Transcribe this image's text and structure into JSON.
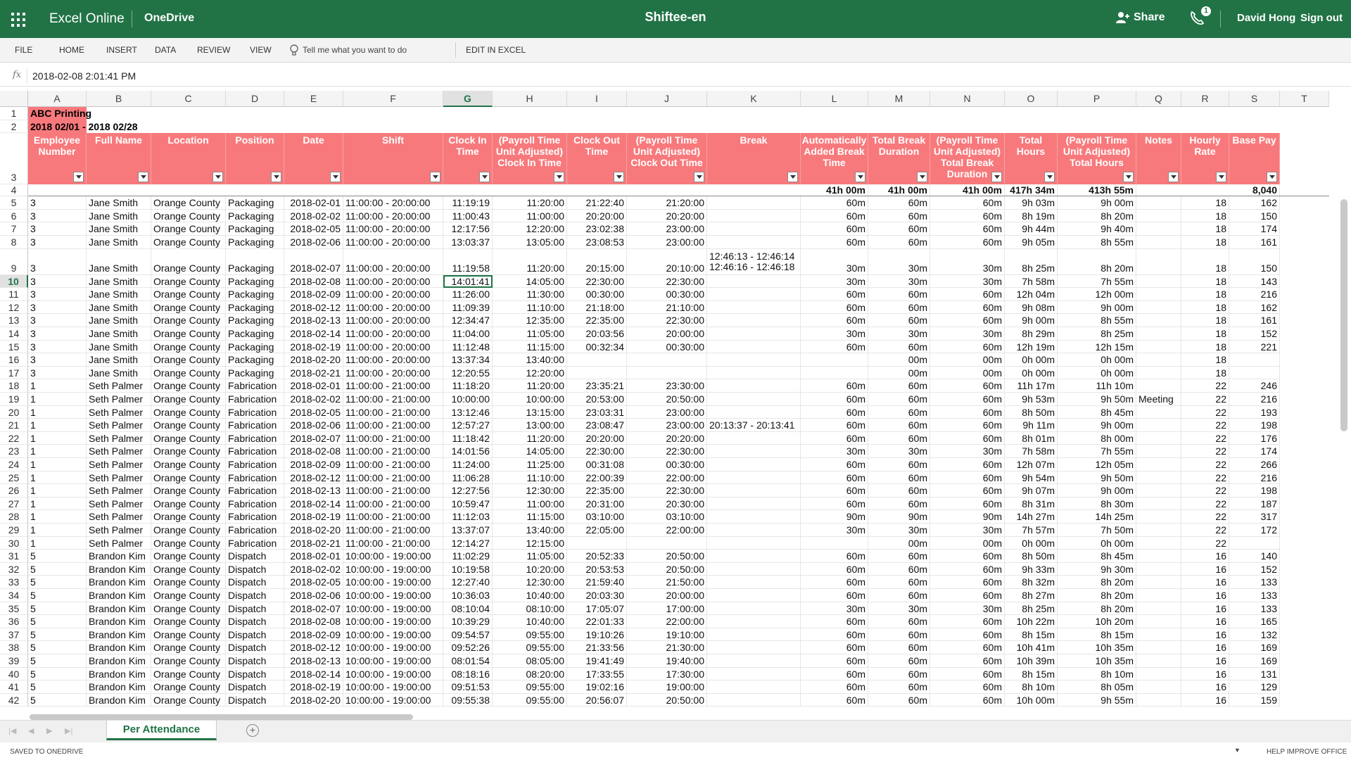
{
  "app": {
    "name": "Excel Online",
    "service": "OneDrive",
    "doc_title": "Shiftee-en",
    "share": "Share",
    "notification_count": "1",
    "user": "David Hong",
    "signout": "Sign out"
  },
  "ribbon": {
    "tabs": [
      "FILE",
      "HOME",
      "INSERT",
      "DATA",
      "REVIEW",
      "VIEW"
    ],
    "tellme": "Tell me what you want to do",
    "edit_in_excel": "EDIT IN EXCEL"
  },
  "formula": {
    "fx": "fx",
    "value": "2018-02-08  2:01:41 PM"
  },
  "columns": [
    "A",
    "B",
    "C",
    "D",
    "E",
    "F",
    "G",
    "H",
    "I",
    "J",
    "K",
    "L",
    "M",
    "N",
    "O",
    "P",
    "Q",
    "R",
    "S",
    "T"
  ],
  "selected_column": "G",
  "selected_row": "10",
  "sheet_title": "ABC Printing",
  "sheet_period": "2018 02/01 - 2018 02/28",
  "headers": [
    "Employee Number",
    "Full Name",
    "Location",
    "Position",
    "Date",
    "Shift",
    "Clock In Time",
    "(Payroll Time Unit Adjusted) Clock In Time",
    "Clock Out Time",
    "(Payroll Time Unit Adjusted) Clock Out Time",
    "Break",
    "Automatically Added Break Time",
    "Total Break Duration",
    "(Payroll Time Unit Adjusted) Total Break Duration",
    "Total Hours",
    "(Payroll Time Unit Adjusted) Total Hours",
    "Notes",
    "Hourly Rate",
    "Base Pay"
  ],
  "totals": {
    "L": "41h 00m",
    "M": "41h 00m",
    "N": "41h 00m",
    "O": "417h 34m",
    "P": "413h 55m",
    "S": "8,040"
  },
  "rows": [
    [
      "5",
      "3",
      "Jane Smith",
      "Orange County",
      "Packaging",
      "2018-02-01",
      "11:00:00 - 20:00:00",
      "11:19:19",
      "11:20:00",
      "21:22:40",
      "21:20:00",
      "",
      "60m",
      "60m",
      "60m",
      "9h 03m",
      "9h 00m",
      "",
      "18",
      "162"
    ],
    [
      "6",
      "3",
      "Jane Smith",
      "Orange County",
      "Packaging",
      "2018-02-02",
      "11:00:00 - 20:00:00",
      "11:00:43",
      "11:00:00",
      "20:20:00",
      "20:20:00",
      "",
      "60m",
      "60m",
      "60m",
      "8h 19m",
      "8h 20m",
      "",
      "18",
      "150"
    ],
    [
      "7",
      "3",
      "Jane Smith",
      "Orange County",
      "Packaging",
      "2018-02-05",
      "11:00:00 - 20:00:00",
      "12:17:56",
      "12:20:00",
      "23:02:38",
      "23:00:00",
      "",
      "60m",
      "60m",
      "60m",
      "9h 44m",
      "9h 40m",
      "",
      "18",
      "174"
    ],
    [
      "8",
      "3",
      "Jane Smith",
      "Orange County",
      "Packaging",
      "2018-02-06",
      "11:00:00 - 20:00:00",
      "13:03:37",
      "13:05:00",
      "23:08:53",
      "23:00:00",
      "",
      "60m",
      "60m",
      "60m",
      "9h 05m",
      "8h 55m",
      "",
      "18",
      "161"
    ],
    [
      "9",
      "3",
      "Jane Smith",
      "Orange County",
      "Packaging",
      "2018-02-07",
      "11:00:00 - 20:00:00",
      "11:19:58",
      "11:20:00",
      "20:15:00",
      "20:10:00",
      "12:46:13 - 12:46:14\n12:46:16 - 12:46:18",
      "30m",
      "30m",
      "30m",
      "8h 25m",
      "8h 20m",
      "",
      "18",
      "150"
    ],
    [
      "10",
      "3",
      "Jane Smith",
      "Orange County",
      "Packaging",
      "2018-02-08",
      "11:00:00 - 20:00:00",
      "14:01:41",
      "14:05:00",
      "22:30:00",
      "22:30:00",
      "",
      "30m",
      "30m",
      "30m",
      "7h 58m",
      "7h 55m",
      "",
      "18",
      "143"
    ],
    [
      "11",
      "3",
      "Jane Smith",
      "Orange County",
      "Packaging",
      "2018-02-09",
      "11:00:00 - 20:00:00",
      "11:26:00",
      "11:30:00",
      "00:30:00",
      "00:30:00",
      "",
      "60m",
      "60m",
      "60m",
      "12h 04m",
      "12h 00m",
      "",
      "18",
      "216"
    ],
    [
      "12",
      "3",
      "Jane Smith",
      "Orange County",
      "Packaging",
      "2018-02-12",
      "11:00:00 - 20:00:00",
      "11:09:39",
      "11:10:00",
      "21:18:00",
      "21:10:00",
      "",
      "60m",
      "60m",
      "60m",
      "9h 08m",
      "9h 00m",
      "",
      "18",
      "162"
    ],
    [
      "13",
      "3",
      "Jane Smith",
      "Orange County",
      "Packaging",
      "2018-02-13",
      "11:00:00 - 20:00:00",
      "12:34:47",
      "12:35:00",
      "22:35:00",
      "22:30:00",
      "",
      "60m",
      "60m",
      "60m",
      "9h 00m",
      "8h 55m",
      "",
      "18",
      "161"
    ],
    [
      "14",
      "3",
      "Jane Smith",
      "Orange County",
      "Packaging",
      "2018-02-14",
      "11:00:00 - 20:00:00",
      "11:04:00",
      "11:05:00",
      "20:03:56",
      "20:00:00",
      "",
      "30m",
      "30m",
      "30m",
      "8h 29m",
      "8h 25m",
      "",
      "18",
      "152"
    ],
    [
      "15",
      "3",
      "Jane Smith",
      "Orange County",
      "Packaging",
      "2018-02-19",
      "11:00:00 - 20:00:00",
      "11:12:48",
      "11:15:00",
      "00:32:34",
      "00:30:00",
      "",
      "60m",
      "60m",
      "60m",
      "12h 19m",
      "12h 15m",
      "",
      "18",
      "221"
    ],
    [
      "16",
      "3",
      "Jane Smith",
      "Orange County",
      "Packaging",
      "2018-02-20",
      "11:00:00 - 20:00:00",
      "13:37:34",
      "13:40:00",
      "",
      "",
      "",
      "",
      "00m",
      "00m",
      "0h 00m",
      "0h 00m",
      "",
      "18",
      ""
    ],
    [
      "17",
      "3",
      "Jane Smith",
      "Orange County",
      "Packaging",
      "2018-02-21",
      "11:00:00 - 20:00:00",
      "12:20:55",
      "12:20:00",
      "",
      "",
      "",
      "",
      "00m",
      "00m",
      "0h 00m",
      "0h 00m",
      "",
      "18",
      ""
    ],
    [
      "18",
      "1",
      "Seth Palmer",
      "Orange County",
      "Fabrication",
      "2018-02-01",
      "11:00:00 - 21:00:00",
      "11:18:20",
      "11:20:00",
      "23:35:21",
      "23:30:00",
      "",
      "60m",
      "60m",
      "60m",
      "11h 17m",
      "11h 10m",
      "",
      "22",
      "246"
    ],
    [
      "19",
      "1",
      "Seth Palmer",
      "Orange County",
      "Fabrication",
      "2018-02-02",
      "11:00:00 - 21:00:00",
      "10:00:00",
      "10:00:00",
      "20:53:00",
      "20:50:00",
      "",
      "60m",
      "60m",
      "60m",
      "9h 53m",
      "9h 50m",
      "Meeting",
      "22",
      "216"
    ],
    [
      "20",
      "1",
      "Seth Palmer",
      "Orange County",
      "Fabrication",
      "2018-02-05",
      "11:00:00 - 21:00:00",
      "13:12:46",
      "13:15:00",
      "23:03:31",
      "23:00:00",
      "",
      "60m",
      "60m",
      "60m",
      "8h 50m",
      "8h 45m",
      "",
      "22",
      "193"
    ],
    [
      "21",
      "1",
      "Seth Palmer",
      "Orange County",
      "Fabrication",
      "2018-02-06",
      "11:00:00 - 21:00:00",
      "12:57:27",
      "13:00:00",
      "23:08:47",
      "23:00:00",
      "20:13:37 - 20:13:41",
      "60m",
      "60m",
      "60m",
      "9h 11m",
      "9h 00m",
      "",
      "22",
      "198"
    ],
    [
      "22",
      "1",
      "Seth Palmer",
      "Orange County",
      "Fabrication",
      "2018-02-07",
      "11:00:00 - 21:00:00",
      "11:18:42",
      "11:20:00",
      "20:20:00",
      "20:20:00",
      "",
      "60m",
      "60m",
      "60m",
      "8h 01m",
      "8h 00m",
      "",
      "22",
      "176"
    ],
    [
      "23",
      "1",
      "Seth Palmer",
      "Orange County",
      "Fabrication",
      "2018-02-08",
      "11:00:00 - 21:00:00",
      "14:01:56",
      "14:05:00",
      "22:30:00",
      "22:30:00",
      "",
      "30m",
      "30m",
      "30m",
      "7h 58m",
      "7h 55m",
      "",
      "22",
      "174"
    ],
    [
      "24",
      "1",
      "Seth Palmer",
      "Orange County",
      "Fabrication",
      "2018-02-09",
      "11:00:00 - 21:00:00",
      "11:24:00",
      "11:25:00",
      "00:31:08",
      "00:30:00",
      "",
      "60m",
      "60m",
      "60m",
      "12h 07m",
      "12h 05m",
      "",
      "22",
      "266"
    ],
    [
      "25",
      "1",
      "Seth Palmer",
      "Orange County",
      "Fabrication",
      "2018-02-12",
      "11:00:00 - 21:00:00",
      "11:06:28",
      "11:10:00",
      "22:00:39",
      "22:00:00",
      "",
      "60m",
      "60m",
      "60m",
      "9h 54m",
      "9h 50m",
      "",
      "22",
      "216"
    ],
    [
      "26",
      "1",
      "Seth Palmer",
      "Orange County",
      "Fabrication",
      "2018-02-13",
      "11:00:00 - 21:00:00",
      "12:27:56",
      "12:30:00",
      "22:35:00",
      "22:30:00",
      "",
      "60m",
      "60m",
      "60m",
      "9h 07m",
      "9h 00m",
      "",
      "22",
      "198"
    ],
    [
      "27",
      "1",
      "Seth Palmer",
      "Orange County",
      "Fabrication",
      "2018-02-14",
      "11:00:00 - 21:00:00",
      "10:59:47",
      "11:00:00",
      "20:31:00",
      "20:30:00",
      "",
      "60m",
      "60m",
      "60m",
      "8h 31m",
      "8h 30m",
      "",
      "22",
      "187"
    ],
    [
      "28",
      "1",
      "Seth Palmer",
      "Orange County",
      "Fabrication",
      "2018-02-19",
      "11:00:00 - 21:00:00",
      "11:12:03",
      "11:15:00",
      "03:10:00",
      "03:10:00",
      "",
      "90m",
      "90m",
      "90m",
      "14h 27m",
      "14h 25m",
      "",
      "22",
      "317"
    ],
    [
      "29",
      "1",
      "Seth Palmer",
      "Orange County",
      "Fabrication",
      "2018-02-20",
      "11:00:00 - 21:00:00",
      "13:37:07",
      "13:40:00",
      "22:05:00",
      "22:00:00",
      "",
      "30m",
      "30m",
      "30m",
      "7h 57m",
      "7h 50m",
      "",
      "22",
      "172"
    ],
    [
      "30",
      "1",
      "Seth Palmer",
      "Orange County",
      "Fabrication",
      "2018-02-21",
      "11:00:00 - 21:00:00",
      "12:14:27",
      "12:15:00",
      "",
      "",
      "",
      "",
      "00m",
      "00m",
      "0h 00m",
      "0h 00m",
      "",
      "22",
      ""
    ],
    [
      "31",
      "5",
      "Brandon Kim",
      "Orange County",
      "Dispatch",
      "2018-02-01",
      "10:00:00 - 19:00:00",
      "11:02:29",
      "11:05:00",
      "20:52:33",
      "20:50:00",
      "",
      "60m",
      "60m",
      "60m",
      "8h 50m",
      "8h 45m",
      "",
      "16",
      "140"
    ],
    [
      "32",
      "5",
      "Brandon Kim",
      "Orange County",
      "Dispatch",
      "2018-02-02",
      "10:00:00 - 19:00:00",
      "10:19:58",
      "10:20:00",
      "20:53:53",
      "20:50:00",
      "",
      "60m",
      "60m",
      "60m",
      "9h 33m",
      "9h 30m",
      "",
      "16",
      "152"
    ],
    [
      "33",
      "5",
      "Brandon Kim",
      "Orange County",
      "Dispatch",
      "2018-02-05",
      "10:00:00 - 19:00:00",
      "12:27:40",
      "12:30:00",
      "21:59:40",
      "21:50:00",
      "",
      "60m",
      "60m",
      "60m",
      "8h 32m",
      "8h 20m",
      "",
      "16",
      "133"
    ],
    [
      "34",
      "5",
      "Brandon Kim",
      "Orange County",
      "Dispatch",
      "2018-02-06",
      "10:00:00 - 19:00:00",
      "10:36:03",
      "10:40:00",
      "20:03:30",
      "20:00:00",
      "",
      "60m",
      "60m",
      "60m",
      "8h 27m",
      "8h 20m",
      "",
      "16",
      "133"
    ],
    [
      "35",
      "5",
      "Brandon Kim",
      "Orange County",
      "Dispatch",
      "2018-02-07",
      "10:00:00 - 19:00:00",
      "08:10:04",
      "08:10:00",
      "17:05:07",
      "17:00:00",
      "",
      "30m",
      "30m",
      "30m",
      "8h 25m",
      "8h 20m",
      "",
      "16",
      "133"
    ],
    [
      "36",
      "5",
      "Brandon Kim",
      "Orange County",
      "Dispatch",
      "2018-02-08",
      "10:00:00 - 19:00:00",
      "10:39:29",
      "10:40:00",
      "22:01:33",
      "22:00:00",
      "",
      "60m",
      "60m",
      "60m",
      "10h 22m",
      "10h 20m",
      "",
      "16",
      "165"
    ],
    [
      "37",
      "5",
      "Brandon Kim",
      "Orange County",
      "Dispatch",
      "2018-02-09",
      "10:00:00 - 19:00:00",
      "09:54:57",
      "09:55:00",
      "19:10:26",
      "19:10:00",
      "",
      "60m",
      "60m",
      "60m",
      "8h 15m",
      "8h 15m",
      "",
      "16",
      "132"
    ],
    [
      "38",
      "5",
      "Brandon Kim",
      "Orange County",
      "Dispatch",
      "2018-02-12",
      "10:00:00 - 19:00:00",
      "09:52:26",
      "09:55:00",
      "21:33:56",
      "21:30:00",
      "",
      "60m",
      "60m",
      "60m",
      "10h 41m",
      "10h 35m",
      "",
      "16",
      "169"
    ],
    [
      "39",
      "5",
      "Brandon Kim",
      "Orange County",
      "Dispatch",
      "2018-02-13",
      "10:00:00 - 19:00:00",
      "08:01:54",
      "08:05:00",
      "19:41:49",
      "19:40:00",
      "",
      "60m",
      "60m",
      "60m",
      "10h 39m",
      "10h 35m",
      "",
      "16",
      "169"
    ],
    [
      "40",
      "5",
      "Brandon Kim",
      "Orange County",
      "Dispatch",
      "2018-02-14",
      "10:00:00 - 19:00:00",
      "08:18:16",
      "08:20:00",
      "17:33:55",
      "17:30:00",
      "",
      "60m",
      "60m",
      "60m",
      "8h 15m",
      "8h 10m",
      "",
      "16",
      "131"
    ],
    [
      "41",
      "5",
      "Brandon Kim",
      "Orange County",
      "Dispatch",
      "2018-02-19",
      "10:00:00 - 19:00:00",
      "09:51:53",
      "09:55:00",
      "19:02:16",
      "19:00:00",
      "",
      "60m",
      "60m",
      "60m",
      "8h 10m",
      "8h 05m",
      "",
      "16",
      "129"
    ],
    [
      "42",
      "5",
      "Brandon Kim",
      "Orange County",
      "Dispatch",
      "2018-02-20",
      "10:00:00 - 19:00:00",
      "09:55:38",
      "09:55:00",
      "20:56:07",
      "20:50:00",
      "",
      "60m",
      "60m",
      "60m",
      "10h 00m",
      "9h 55m",
      "",
      "16",
      "159"
    ]
  ],
  "sheet_tab": "Per Attendance",
  "status": {
    "left": "SAVED TO ONEDRIVE",
    "right": "HELP IMPROVE OFFICE"
  },
  "colors": {
    "brand": "#217346",
    "header_fill": "#f8797c"
  }
}
